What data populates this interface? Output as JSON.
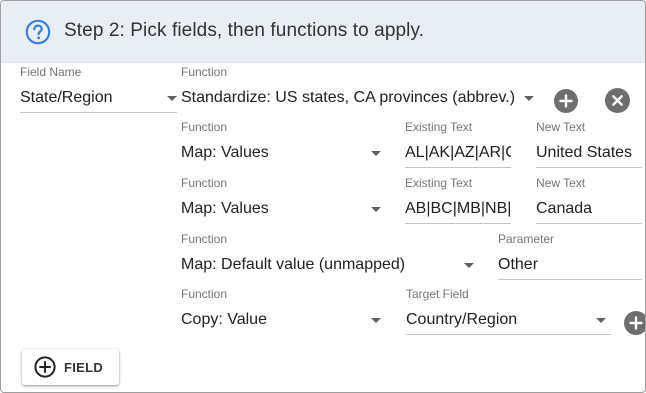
{
  "header": {
    "title": "Step 2: Pick fields, then functions to apply.",
    "help_icon": "question-circle-icon",
    "accent_color": "#3d7fd9"
  },
  "main_row": {
    "field_name_label": "Field Name",
    "field_name_value": "State/Region",
    "function_label": "Function",
    "function_value": "Standardize: US states, CA provinces (abbrev.)",
    "add_icon": "plus-circle-icon",
    "remove_icon": "close-circle-icon"
  },
  "sub_rows": [
    {
      "function_label": "Function",
      "function_value": "Map: Values",
      "existing_label": "Existing Text",
      "existing_value": "AL|AK|AZ|AR|C",
      "new_label": "New Text",
      "new_value": "United States"
    },
    {
      "function_label": "Function",
      "function_value": "Map: Values",
      "existing_label": "Existing Text",
      "existing_value": "AB|BC|MB|NB|I",
      "new_label": "New Text",
      "new_value": "Canada"
    },
    {
      "function_label": "Function",
      "function_value": "Map: Default value (unmapped)",
      "param_label": "Parameter",
      "param_value": "Other"
    },
    {
      "function_label": "Function",
      "function_value": "Copy: Value",
      "target_label": "Target Field",
      "target_value": "Country/Region",
      "add_icon": "plus-circle-icon"
    }
  ],
  "field_button": {
    "label": "FIELD",
    "icon": "plus-circle-outline-icon"
  },
  "colors": {
    "header_bg": "#e8eef3",
    "icon_button_bg": "#6e6e6e",
    "label_gray": "#757575"
  }
}
